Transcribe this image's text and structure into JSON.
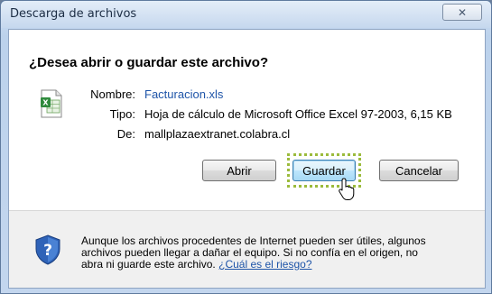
{
  "window": {
    "title": "Descarga de archivos",
    "close_glyph": "✕"
  },
  "dialog": {
    "question": "¿Desea abrir o guardar este archivo?",
    "file_icon": "excel-file-icon",
    "fields": {
      "name_label": "Nombre:",
      "name_value": "Facturacion.xls",
      "type_label": "Tipo:",
      "type_value": "Hoja de cálculo de Microsoft Office Excel 97-2003, 6,15 KB",
      "from_label": "De:",
      "from_value": "mallplazaextranet.colabra.cl"
    },
    "buttons": {
      "open": "Abrir",
      "save": "Guardar",
      "cancel": "Cancelar"
    },
    "warning": {
      "icon": "shield-question-icon",
      "text": "Aunque los archivos procedentes de Internet pueden ser útiles, algunos archivos pueden llegar a dañar el equipo. Si no confía en el origen, no abra ni guarde este archivo.",
      "link": "¿Cuál es el riesgo?"
    }
  },
  "colors": {
    "link": "#1e54a8",
    "focus_ring": "#9bbb3c",
    "frame": "#c3d6ee"
  }
}
